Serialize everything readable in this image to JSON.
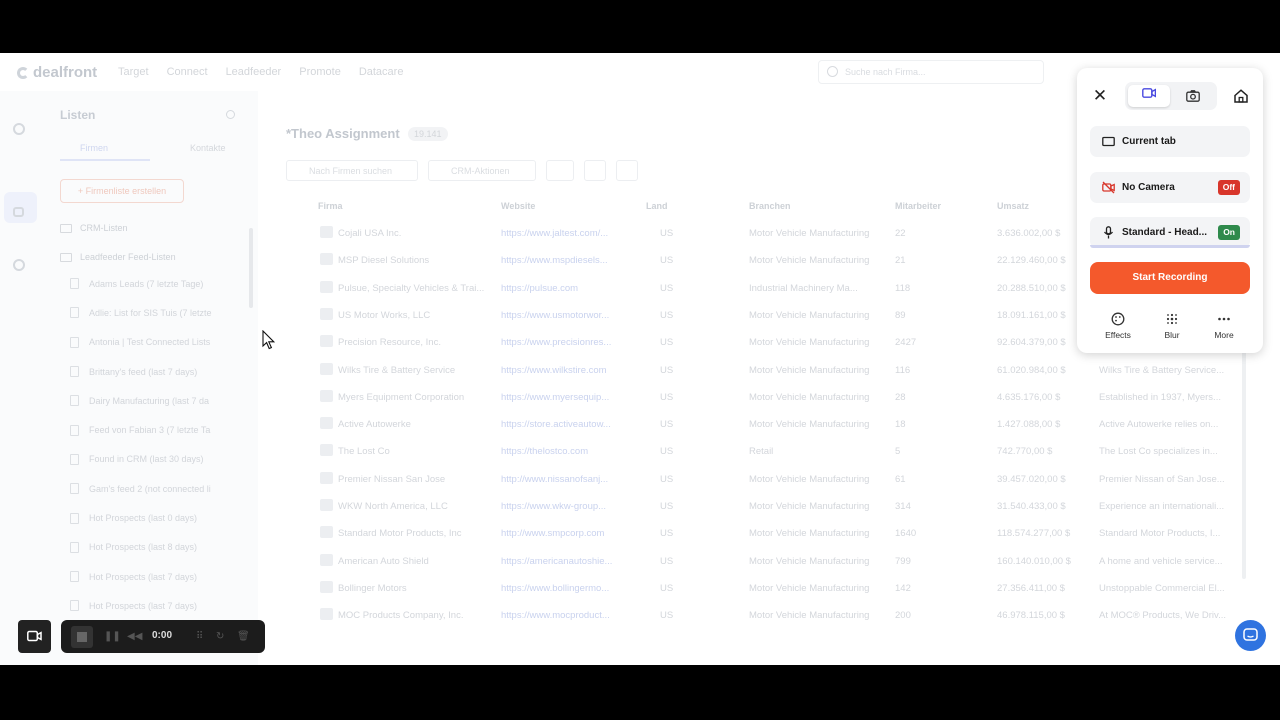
{
  "app": {
    "logo": "dealfront",
    "nav": [
      "Target",
      "Connect",
      "Leadfeeder",
      "Promote",
      "Datacare"
    ],
    "search_placeholder": "Suche nach Firma..."
  },
  "lists_panel": {
    "title": "Listen",
    "tab_companies": "Firmen",
    "tab_contacts": "Kontakte",
    "create_button": "+ Firmenliste erstellen",
    "folder_crm": "CRM-Listen",
    "folder_feed": "Leadfeeder Feed-Listen",
    "items": [
      "Adams Leads (7 letzte Tage)",
      "Adlie: List for SIS Tuis (7 letzte",
      "Antonia | Test Connected Lists",
      "Brittany's feed (last 7 days)",
      "Dairy Manufacturing (last 7 da",
      "Feed von Fabian 3 (7 letzte Ta",
      "Found in CRM (last 30 days)",
      "Gam's feed 2 (not connected li",
      "Hot Prospects (last 0 days)",
      "Hot Prospects (last 8 days)",
      "Hot Prospects (last 7 days)",
      "Hot Prospects (last 7 days)"
    ]
  },
  "main": {
    "title": "*Theo Assignment",
    "count": "19.141",
    "filter_search": "Nach Firmen suchen",
    "filter_crm": "CRM-Aktionen",
    "columns": [
      "Firma",
      "Website",
      "Land",
      "Branchen",
      "Mitarbeiter",
      "Umsatz"
    ],
    "rows": [
      {
        "name": "Cojali USA Inc.",
        "web": "https://www.jaltest.com/...",
        "land": "US",
        "branche": "Motor Vehicle Manufacturing",
        "emp": "22",
        "rev": "3.636.002,00 $",
        "desc": ""
      },
      {
        "name": "MSP Diesel Solutions",
        "web": "https://www.mspdiesels...",
        "land": "US",
        "branche": "Motor Vehicle Manufacturing",
        "emp": "21",
        "rev": "22.129.460,00 $",
        "desc": ""
      },
      {
        "name": "Pulsue, Specialty Vehicles & Trai...",
        "web": "https://pulsue.com",
        "land": "US",
        "branche": "Industrial Machinery Ma...",
        "emp": "118",
        "rev": "20.288.510,00 $",
        "desc": ""
      },
      {
        "name": "US Motor Works, LLC",
        "web": "https://www.usmotorwor...",
        "land": "US",
        "branche": "Motor Vehicle Manufacturing",
        "emp": "89",
        "rev": "18.091.161,00 $",
        "desc": ""
      },
      {
        "name": "Precision Resource, Inc.",
        "web": "https://www.precisionres...",
        "land": "US",
        "branche": "Motor Vehicle Manufacturing",
        "emp": "2427",
        "rev": "92.604.379,00 $",
        "desc": ""
      },
      {
        "name": "Wilks Tire & Battery Service",
        "web": "https://www.wilkstire.com",
        "land": "US",
        "branche": "Motor Vehicle Manufacturing",
        "emp": "116",
        "rev": "61.020.984,00 $",
        "desc": "Wilks Tire & Battery Service..."
      },
      {
        "name": "Myers Equipment Corporation",
        "web": "https://www.myersequip...",
        "land": "US",
        "branche": "Motor Vehicle Manufacturing",
        "emp": "28",
        "rev": "4.635.176,00 $",
        "desc": "Established in 1937, Myers..."
      },
      {
        "name": "Active Autowerke",
        "web": "https://store.activeautow...",
        "land": "US",
        "branche": "Motor Vehicle Manufacturing",
        "emp": "18",
        "rev": "1.427.088,00 $",
        "desc": "Active Autowerke relies on..."
      },
      {
        "name": "The Lost Co",
        "web": "https://thelostco.com",
        "land": "US",
        "branche": "Retail",
        "emp": "5",
        "rev": "742.770,00 $",
        "desc": "The Lost Co specializes in..."
      },
      {
        "name": "Premier Nissan San Jose",
        "web": "http://www.nissanofsanj...",
        "land": "US",
        "branche": "Motor Vehicle Manufacturing",
        "emp": "61",
        "rev": "39.457.020,00 $",
        "desc": "Premier Nissan of San Jose..."
      },
      {
        "name": "WKW North America, LLC",
        "web": "https://www.wkw-group...",
        "land": "US",
        "branche": "Motor Vehicle Manufacturing",
        "emp": "314",
        "rev": "31.540.433,00 $",
        "desc": "Experience an internationali..."
      },
      {
        "name": "Standard Motor Products, Inc",
        "web": "http://www.smpcorp.com",
        "land": "US",
        "branche": "Motor Vehicle Manufacturing",
        "emp": "1640",
        "rev": "118.574.277,00 $",
        "desc": "Standard Motor Products, I..."
      },
      {
        "name": "American Auto Shield",
        "web": "https://americanautoshie...",
        "land": "US",
        "branche": "Motor Vehicle Manufacturing",
        "emp": "799",
        "rev": "160.140.010,00 $",
        "desc": "A home and vehicle service..."
      },
      {
        "name": "Bollinger Motors",
        "web": "https://www.bollingermo...",
        "land": "US",
        "branche": "Motor Vehicle Manufacturing",
        "emp": "142",
        "rev": "27.356.411,00 $",
        "desc": "Unstoppable Commercial El..."
      },
      {
        "name": "MOC Products Company, Inc.",
        "web": "https://www.mocproduct...",
        "land": "US",
        "branche": "Motor Vehicle Manufacturing",
        "emp": "200",
        "rev": "46.978.115,00 $",
        "desc": "At MOC® Products, We Driv..."
      }
    ]
  },
  "recorder": {
    "current_tab": "Current tab",
    "camera_label": "No Camera",
    "camera_state": "Off",
    "mic_label": "Standard - Head...",
    "mic_state": "On",
    "start_button": "Start Recording",
    "tool_effects": "Effects",
    "tool_blur": "Blur",
    "tool_more": "More",
    "timer": "0:00",
    "accent": "#f4592c"
  }
}
